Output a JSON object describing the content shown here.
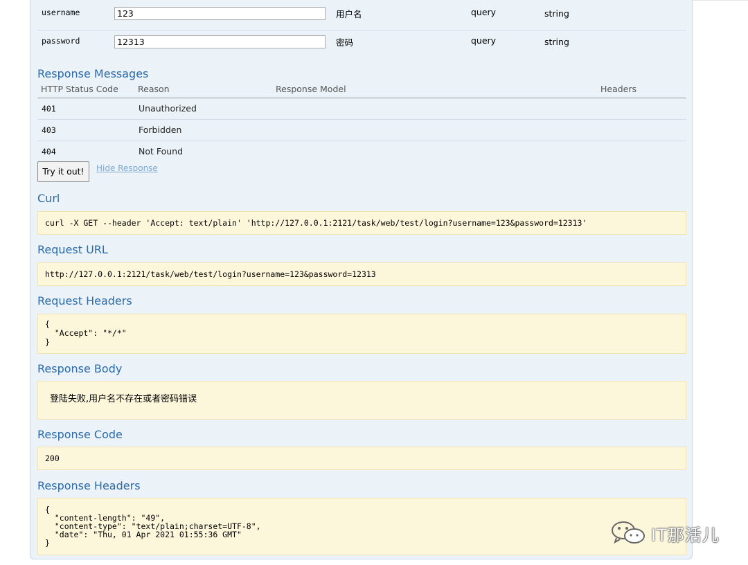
{
  "parameters": [
    {
      "name": "username",
      "value": "123",
      "description": "用户名",
      "param_type": "query",
      "data_type": "string"
    },
    {
      "name": "password",
      "value": "12313",
      "description": "密码",
      "param_type": "query",
      "data_type": "string"
    }
  ],
  "response_messages": {
    "title": "Response Messages",
    "headers": {
      "code": "HTTP Status Code",
      "reason": "Reason",
      "model": "Response Model",
      "headers": "Headers"
    },
    "rows": [
      {
        "code": "401",
        "reason": "Unauthorized"
      },
      {
        "code": "403",
        "reason": "Forbidden"
      },
      {
        "code": "404",
        "reason": "Not Found"
      }
    ]
  },
  "actions": {
    "try_label": "Try it out!",
    "hide_label": "Hide Response"
  },
  "curl": {
    "title": "Curl",
    "value": "curl -X GET --header 'Accept: text/plain' 'http://127.0.0.1:2121/task/web/test/login?username=123&password=12313'"
  },
  "request_url": {
    "title": "Request URL",
    "value": "http://127.0.0.1:2121/task/web/test/login?username=123&password=12313"
  },
  "request_headers": {
    "title": "Request Headers",
    "value": "{\n  \"Accept\": \"*/*\"\n}"
  },
  "response_body": {
    "title": "Response Body",
    "value": "登陆失败,用户名不存在或者密码错误"
  },
  "response_code": {
    "title": "Response Code",
    "value": "200"
  },
  "response_headers": {
    "title": "Response Headers",
    "value": "{\n  \"content-length\": \"49\",\n  \"content-type\": \"text/plain;charset=UTF-8\",\n  \"date\": \"Thu, 01 Apr 2021 01:55:36 GMT\"\n}"
  },
  "watermark": {
    "text": "IT那活儿",
    "icon": "wechat-icon"
  }
}
